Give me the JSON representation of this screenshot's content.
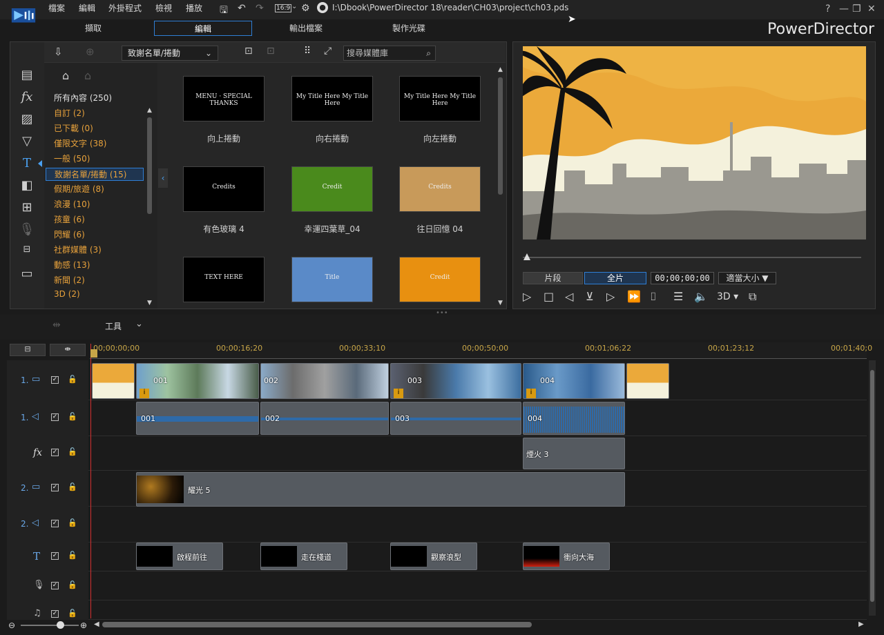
{
  "menu": {
    "file": "檔案",
    "edit": "編輯",
    "plugins": "外掛程式",
    "view": "檢視",
    "play": "播放"
  },
  "toolbar": {
    "aspect": "16:9",
    "filepath": "I:\\Dbook\\PowerDirector 18\\reader\\CH03\\project\\ch03.pds",
    "help": "?"
  },
  "modes": {
    "capture": "擷取",
    "edit": "編輯",
    "produce": "輸出檔案",
    "disc": "製作光碟"
  },
  "brand": "PowerDirector",
  "library": {
    "dropdown": "致謝名單/捲動",
    "search_placeholder": "搜尋媒體庫",
    "categories": [
      {
        "label": "所有內容 (250)",
        "style": "white"
      },
      {
        "label": "自訂  (2)",
        "style": "orange"
      },
      {
        "label": "已下載  (0)",
        "style": "orange"
      },
      {
        "label": "僅限文字  (38)",
        "style": "orange"
      },
      {
        "label": "一般  (50)",
        "style": "orange"
      },
      {
        "label": "致謝名單/捲動  (15)",
        "style": "sel"
      },
      {
        "label": "假期/旅遊  (8)",
        "style": "orange"
      },
      {
        "label": "浪漫  (10)",
        "style": "orange"
      },
      {
        "label": "孩童  (6)",
        "style": "orange"
      },
      {
        "label": "閃耀  (6)",
        "style": "orange"
      },
      {
        "label": "社群媒體  (3)",
        "style": "orange"
      },
      {
        "label": "動感  (13)",
        "style": "orange"
      },
      {
        "label": "新聞  (2)",
        "style": "orange"
      },
      {
        "label": "3D  (2)",
        "style": "orange"
      }
    ],
    "items": [
      {
        "label": "向上捲動",
        "text": "MENU · SPECIAL THANKS",
        "bg": "#000"
      },
      {
        "label": "向右捲動",
        "text": "My Title Here My Title Here",
        "bg": "#000"
      },
      {
        "label": "向左捲動",
        "text": "My Title Here My Title Here",
        "bg": "#000"
      },
      {
        "label": "有色玻璃 4",
        "text": "Credits",
        "bg": "#000"
      },
      {
        "label": "幸運四葉草_04",
        "text": "Credit",
        "bg": "#4a8a1c"
      },
      {
        "label": "往日回憶 04",
        "text": "Credits",
        "bg": "#c89a5a"
      },
      {
        "label": "",
        "text": "TEXT HERE",
        "bg": "#000"
      },
      {
        "label": "",
        "text": "Title",
        "bg": "#5a8ac8"
      },
      {
        "label": "",
        "text": "Credit",
        "bg": "#e89010"
      }
    ]
  },
  "preview": {
    "clip": "片段",
    "movie": "全片",
    "timecode": "00;00;00;00",
    "fit": "適當大小",
    "mode3d": "3D"
  },
  "timeline": {
    "tools": "工具",
    "ruler": [
      "00;00;00;00",
      "00;00;16;20",
      "00;00;33;10",
      "00;00;50;00",
      "00;01;06;22",
      "00;01;23;12",
      "00;01;40;0"
    ],
    "tracks": {
      "v1": "1.",
      "a1": "1.",
      "v2": "2.",
      "a2": "2."
    },
    "video_clips": [
      "001",
      "002",
      "003",
      "004"
    ],
    "audio_clips": [
      "001",
      "002",
      "003",
      "004"
    ],
    "fx_clip": "煙火 3",
    "overlay_clip": "耀光 5",
    "title_clips": [
      "啟程前往",
      "走在棧道",
      "觀察浪型",
      "衝向大海"
    ]
  },
  "colors": {
    "accent": "#2f7fd6",
    "orange": "#e7a13b",
    "playhead": "#d63030"
  }
}
